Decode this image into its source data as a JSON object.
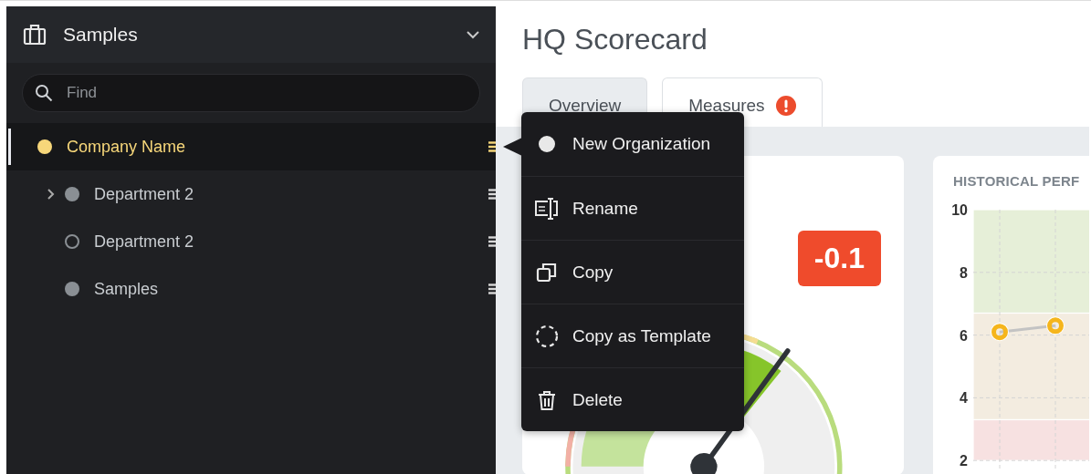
{
  "sidebar": {
    "title": "Samples",
    "search": {
      "placeholder": "Find"
    },
    "tree": [
      {
        "label": "Company Name",
        "selected": true,
        "kind": "filled",
        "color": "#f7d77a",
        "children": [
          {
            "label": "Department 2",
            "selected": false,
            "kind": "filled",
            "color": "#8a8f94",
            "expanded": false
          },
          {
            "label": "Department 2",
            "selected": false,
            "kind": "hollow",
            "color": "#8a8f94"
          },
          {
            "label": "Samples",
            "selected": false,
            "kind": "filled",
            "color": "#8a8f94"
          }
        ]
      }
    ]
  },
  "main": {
    "title": "HQ Scorecard",
    "tabs": [
      {
        "label": "Overview",
        "selected": false,
        "alert": false
      },
      {
        "label": "Measures",
        "selected": true,
        "alert": true
      }
    ],
    "score": {
      "value": "-0.1",
      "color": "#ef4b2c"
    },
    "history": {
      "title": "HISTORICAL PERF",
      "chart_data": {
        "type": "line",
        "yticks": [
          2,
          4,
          6,
          8,
          10
        ],
        "ylim": [
          2,
          10
        ],
        "grid": true,
        "bands": [
          {
            "axis": "y",
            "from": 6.7,
            "to": 10,
            "color": "#e6efd8"
          },
          {
            "axis": "y",
            "from": 3.3,
            "to": 6.7,
            "color": "#f3ece0"
          },
          {
            "axis": "y",
            "from": 2,
            "to": 3.3,
            "color": "#f7e1e1"
          }
        ],
        "series": [
          {
            "color": "#c3c3c3",
            "marker": "o",
            "values": [
              6.1,
              6.3
            ]
          }
        ]
      }
    }
  },
  "context_menu": {
    "items": [
      {
        "kind": "new",
        "label": "New Organization"
      },
      {
        "kind": "rename",
        "label": "Rename"
      },
      {
        "kind": "copy",
        "label": "Copy"
      },
      {
        "kind": "template",
        "label": "Copy as Template"
      },
      {
        "kind": "delete",
        "label": "Delete"
      }
    ]
  }
}
